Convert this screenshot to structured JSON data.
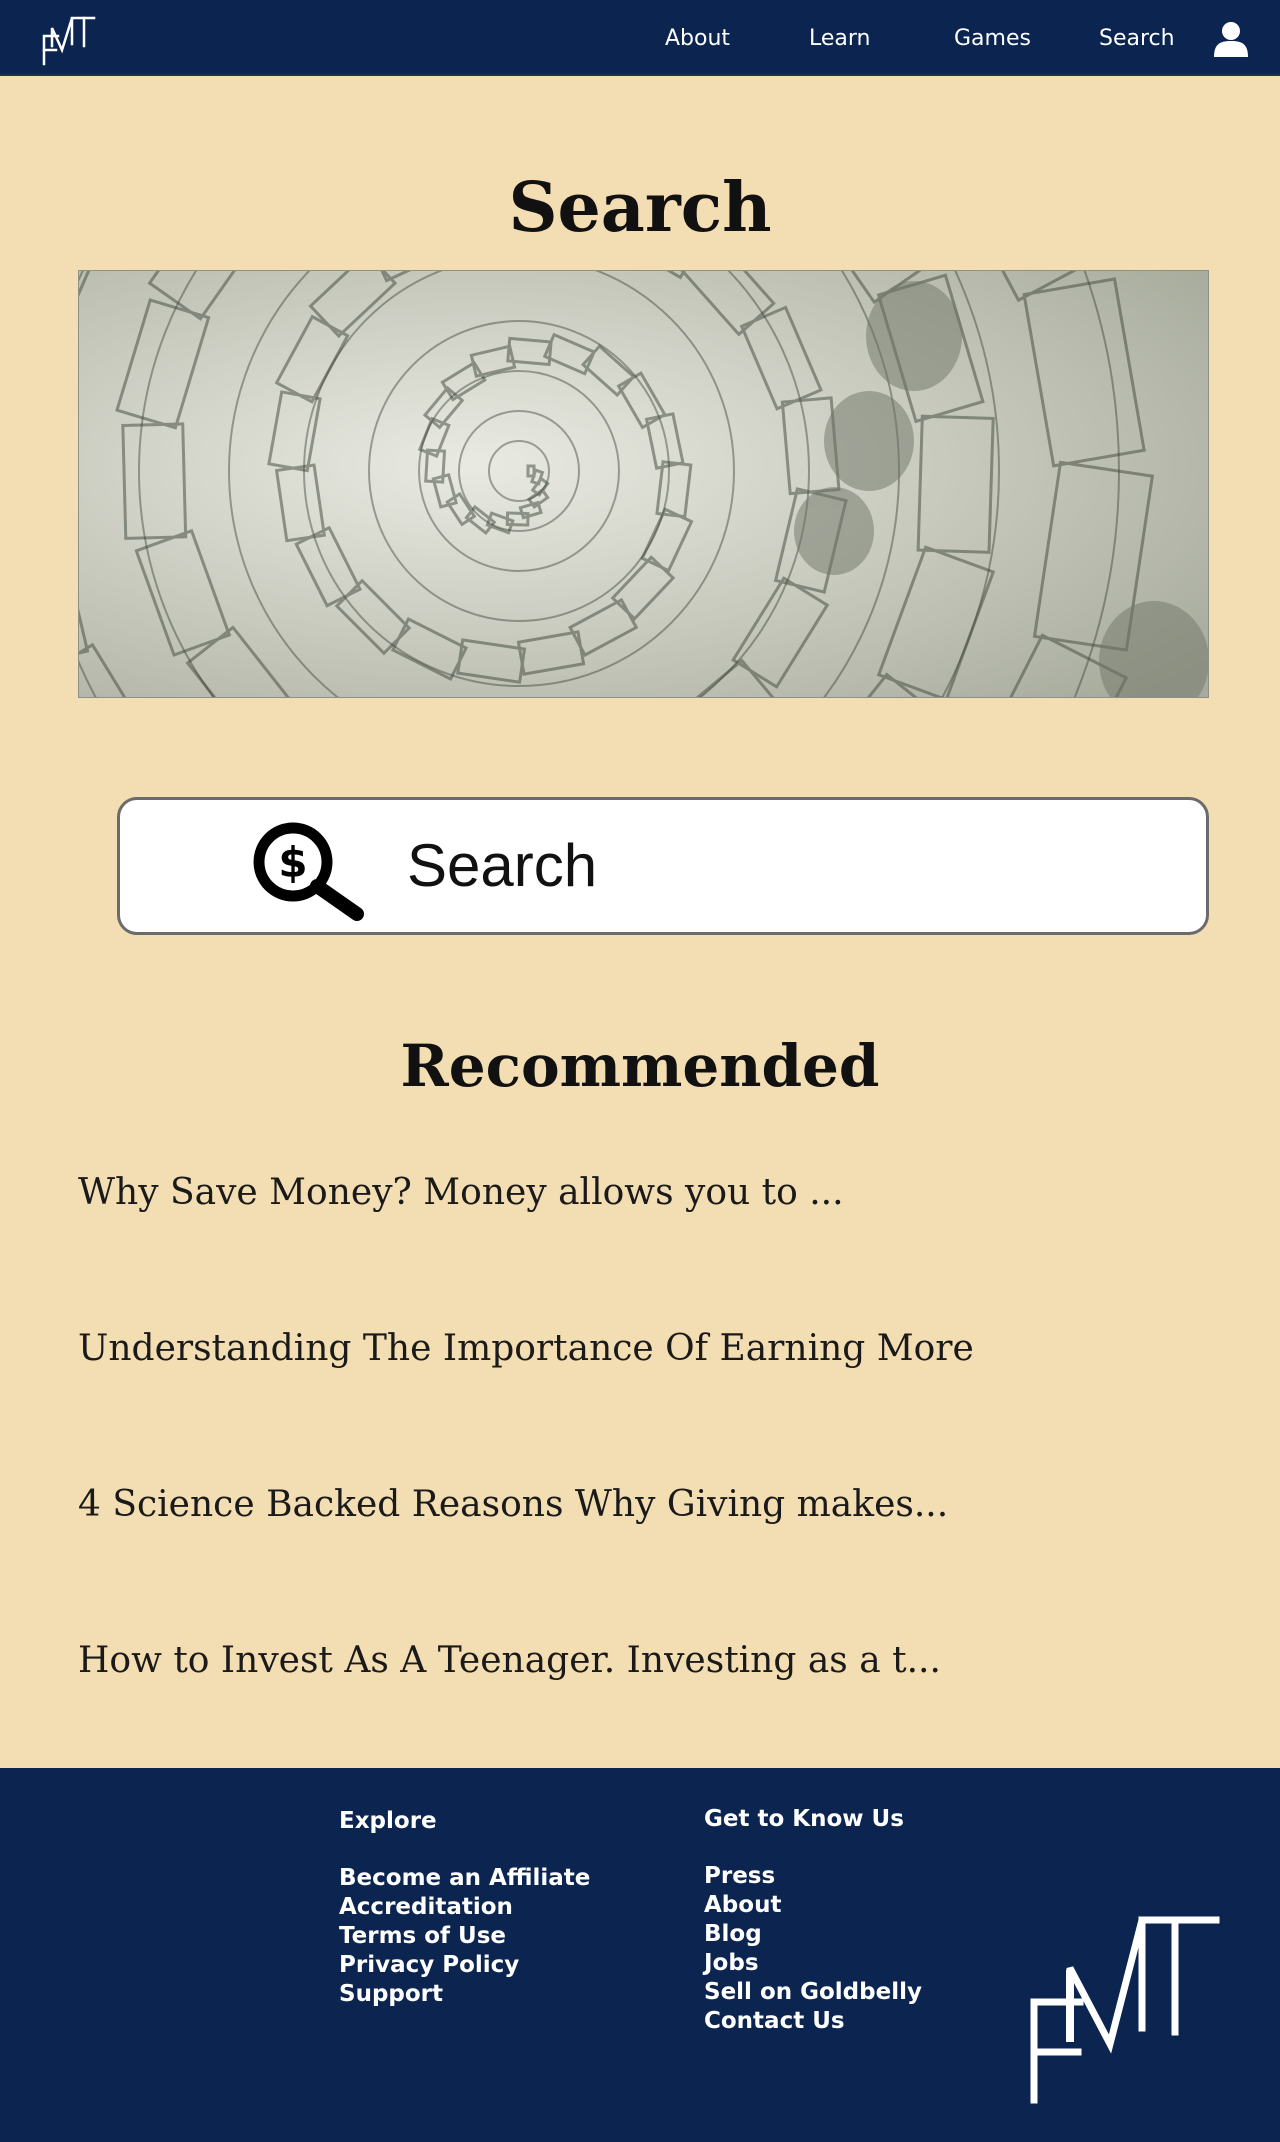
{
  "nav": {
    "logo_text": "FMT",
    "links": [
      "About",
      "Learn",
      "Games",
      "Search"
    ],
    "user_icon": "user-icon"
  },
  "page": {
    "title": "Search"
  },
  "hero": {
    "image": "money-spiral-image"
  },
  "search": {
    "label": "Search",
    "icon": "dollar-magnifier-icon"
  },
  "recommended": {
    "title": "Recommended",
    "items": [
      "Why Save Money? Money allows you to ...",
      "Understanding The Importance Of Earning More",
      "4 Science Backed Reasons Why Giving makes...",
      "How to Invest As A Teenager. Investing as a t..."
    ]
  },
  "footer": {
    "explore": {
      "heading": "Explore",
      "links": [
        "Become an Affiliate",
        "Accreditation",
        "Terms of Use",
        "Privacy Policy",
        "Support"
      ]
    },
    "know_us": {
      "heading": "Get to Know Us",
      "links": [
        "Press",
        "About",
        "Blog",
        "Jobs",
        "Sell on Goldbelly",
        "Contact Us"
      ]
    },
    "logo_text": "FMT"
  },
  "colors": {
    "navy": "#0b2550",
    "background": "#f3ddb2",
    "text": "#111111"
  }
}
